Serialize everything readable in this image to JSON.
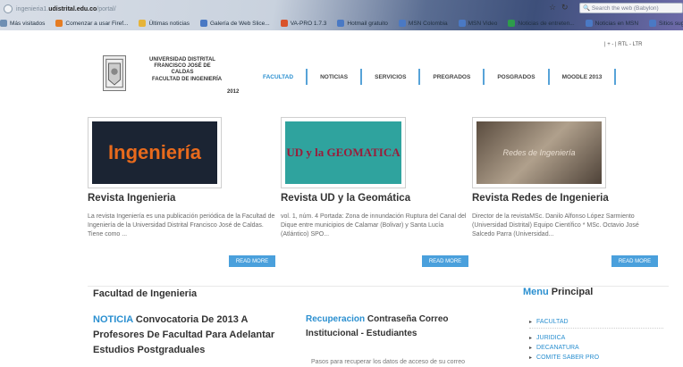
{
  "browser": {
    "url_prefix": "ingenieria1.",
    "url_domain": "udistrital.edu.co",
    "url_path": "/portal/",
    "search_placeholder": "Search the web (Babylon)",
    "bookmarks": [
      {
        "label": "Más visitados",
        "color": "#6f8fb3"
      },
      {
        "label": "Comenzar a usar Firef...",
        "color": "#e57c22"
      },
      {
        "label": "Últimas noticias",
        "color": "#e6b43a"
      },
      {
        "label": "Galería de Web Slice...",
        "color": "#4a79c4"
      },
      {
        "label": "VA-PRO 1.7.3",
        "color": "#d9532b"
      },
      {
        "label": "Hotmail gratuito",
        "color": "#4a79c4"
      },
      {
        "label": "MSN Colombia",
        "color": "#4a79c4"
      },
      {
        "label": "MSN Video",
        "color": "#4a79c4"
      },
      {
        "label": "Noticias de entreten...",
        "color": "#2d9c4b"
      },
      {
        "label": "Noticias en MSN",
        "color": "#4a79c4"
      },
      {
        "label": "Sitios suge",
        "color": "#4a79c4"
      }
    ]
  },
  "header": {
    "rtl_text": "| + - | RTL - LTR",
    "university": "UNIVERSIDAD DISTRITAL FRANCISCO JOSÉ DE CALDAS",
    "faculty": "FACULTAD DE INGENIERÍA",
    "year": "2012"
  },
  "menu": [
    {
      "label": "FACULTAD",
      "active": true
    },
    {
      "label": "NOTICIAS",
      "active": false
    },
    {
      "label": "SERVICIOS",
      "active": false
    },
    {
      "label": "PREGRADOS",
      "active": false
    },
    {
      "label": "POSGRADOS",
      "active": false
    },
    {
      "label": "MOODLE 2013",
      "active": false
    }
  ],
  "cards": [
    {
      "title": "Revista Ingenieria",
      "text": "La revista Ingeniería es una publicación periódica de la Facultad de Ingeniería de la Universidad Distrital Francisco José de Caldas. Tiene como ...",
      "button": "READ MORE",
      "image_text": "Ingeniería"
    },
    {
      "title": "Revista UD y la Geomática",
      "text": "vol. 1, núm. 4 Portada: Zona de innundación Ruptura del Canal del Dique entre municipios de Calamar (Bolivar) y Santa Lucía (Atlántico) SPO...",
      "button": "READ MORE",
      "image_text": "UD y la GEOMATICA"
    },
    {
      "title": "Revista Redes de Ingenieria",
      "text": "Director de la revistaMSc. Danilo Alfonso López Sarmiento (Universidad Distrital) Equipo Científico * MSc. Octavio José Salcedo Parra (Universidad...",
      "button": "READ MORE",
      "image_text": "Redes de Ingeniería"
    }
  ],
  "section": {
    "title": "Facultad de Ingenieria",
    "noticia_key": "NOTICIA",
    "noticia_text": "Convocatoria De 2013 A Profesores De Facultad Para Adelantar Estudios Postgraduales",
    "recup_key": "Recuperacion",
    "recup_text": "Contraseña Correo Institucional - Estudiantes",
    "pasos": "Pasos para recuperar los datos de acceso de su correo"
  },
  "sidebar": {
    "title_key": "Menu",
    "title_rest": "Principal",
    "items": [
      "FACULTAD",
      "JURIDICA",
      "DECANATURA",
      "COMITE SABER PRO"
    ]
  }
}
